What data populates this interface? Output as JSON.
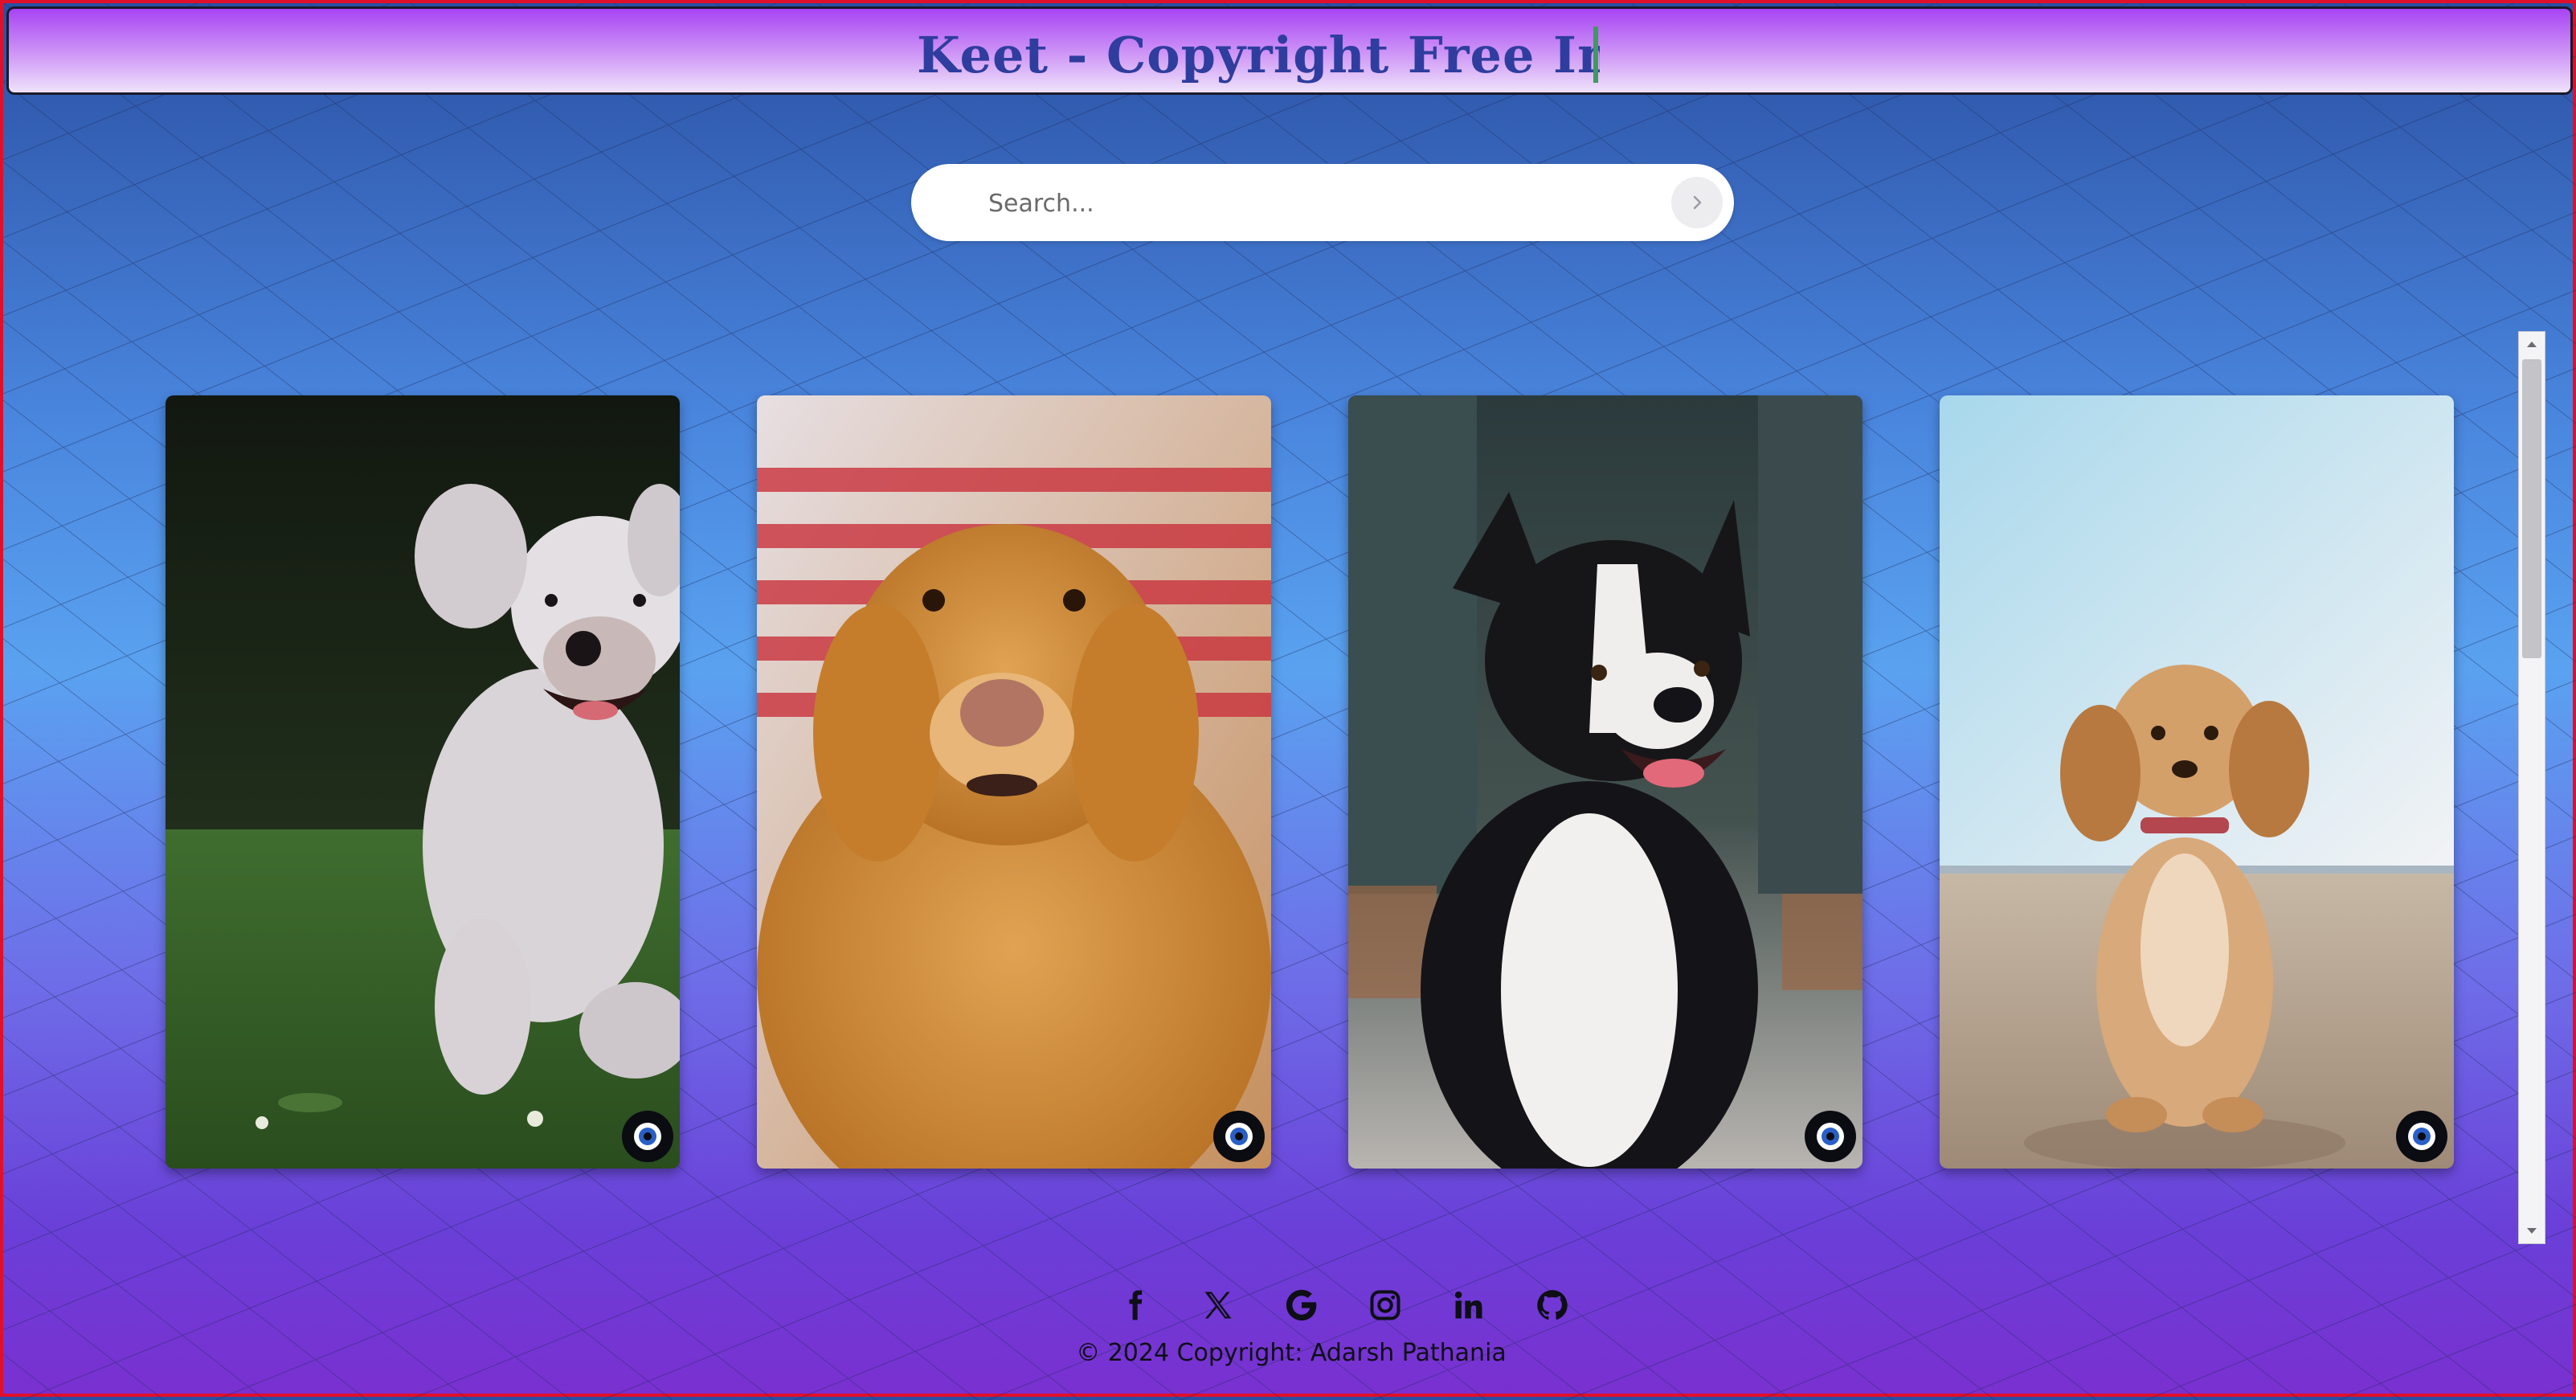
{
  "header": {
    "title": "Keet - Copyright Free Imag"
  },
  "search": {
    "placeholder": "Search...",
    "submit_icon": "chevron-right-icon"
  },
  "gallery": {
    "images": [
      {
        "subject": "white-poodle-running",
        "action_icon": "lens-icon"
      },
      {
        "subject": "golden-retriever",
        "action_icon": "lens-icon"
      },
      {
        "subject": "border-collie",
        "action_icon": "lens-icon"
      },
      {
        "subject": "spaniel-puppy-beach",
        "action_icon": "lens-icon"
      }
    ]
  },
  "footer": {
    "social_links": [
      {
        "icon": "facebook-icon"
      },
      {
        "icon": "x-icon"
      },
      {
        "icon": "google-icon"
      },
      {
        "icon": "instagram-icon"
      },
      {
        "icon": "linkedin-icon"
      },
      {
        "icon": "github-icon"
      }
    ],
    "copyright": "© 2024 Copyright: Adarsh Pathania"
  },
  "colors": {
    "title": "#2f3d9e",
    "border": "#e0102a",
    "header_top": "#a844f4",
    "bg_top": "#2a4fa2",
    "bg_middle": "#5aa2f0",
    "bg_bottom": "#7a30d0"
  }
}
